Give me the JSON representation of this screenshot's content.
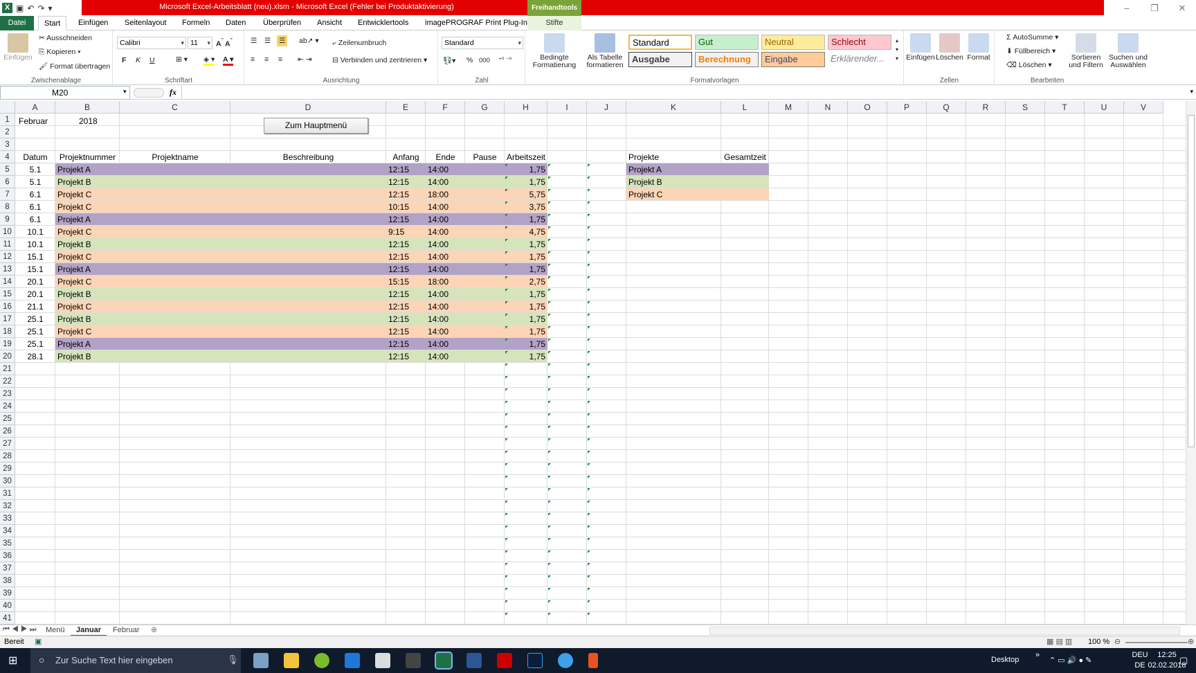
{
  "window": {
    "title": "Microsoft Excel-Arbeitsblatt (neu).xlsm  -  Microsoft Excel (Fehler bei Produktaktivierung)",
    "context_tab": "Freihandtools"
  },
  "tabs": [
    "Datei",
    "Start",
    "Einfügen",
    "Seitenlayout",
    "Formeln",
    "Daten",
    "Überprüfen",
    "Ansicht",
    "Entwicklertools",
    "imagePROGRAF Print Plug-In",
    "Stifte"
  ],
  "ribbon": {
    "clipboard": {
      "label": "Zwischenablage",
      "paste": "Einfügen",
      "cut": "Ausschneiden",
      "copy": "Kopieren",
      "format_painter": "Format übertragen"
    },
    "font": {
      "label": "Schriftart",
      "family": "Calibri",
      "size": "11",
      "bold": "F",
      "italic": "K",
      "underline": "U"
    },
    "alignment": {
      "label": "Ausrichtung",
      "wrap": "Zeilenumbruch",
      "merge": "Verbinden und zentrieren"
    },
    "number": {
      "label": "Zahl",
      "format": "Standard",
      "percent": "%",
      "thousands": "000"
    },
    "styles": {
      "label": "Formatvorlagen",
      "cond_format": "Bedingte Formatierung",
      "as_table": "Als Tabelle formatieren",
      "items": [
        "Standard",
        "Gut",
        "Neutral",
        "Schlecht",
        "Ausgabe",
        "Berechnung",
        "Eingabe",
        "Erklärender..."
      ]
    },
    "cells": {
      "label": "Zellen",
      "insert": "Einfügen",
      "delete": "Löschen",
      "format": "Format"
    },
    "editing": {
      "label": "Bearbeiten",
      "autosum": "AutoSumme",
      "fill": "Füllbereich",
      "clear": "Löschen",
      "sort": "Sortieren und Filtern",
      "find": "Suchen und Auswählen"
    }
  },
  "formula_bar": {
    "name_box": "M20",
    "fx": "fx",
    "value": ""
  },
  "columns": [
    "A",
    "B",
    "C",
    "D",
    "E",
    "F",
    "G",
    "H",
    "I",
    "J",
    "K",
    "L",
    "M",
    "N",
    "O",
    "P",
    "Q",
    "R",
    "S",
    "T",
    "U",
    "V"
  ],
  "rows_count": 41,
  "header_cells": {
    "A1": "Februar",
    "B1": "2018",
    "button": "Zum Hauptmenü"
  },
  "table_headers": [
    "Datum",
    "Projektnummer",
    "Projektname",
    "Beschreibung",
    "Anfang",
    "Ende",
    "Pause",
    "Arbeitszeit"
  ],
  "entries": [
    {
      "datum": "5.1",
      "projekt": "Projekt A",
      "anfang": "12:15",
      "ende": "14:00",
      "zeit": "1,75"
    },
    {
      "datum": "5.1",
      "projekt": "Projekt B",
      "anfang": "12:15",
      "ende": "14:00",
      "zeit": "1,75"
    },
    {
      "datum": "6.1",
      "projekt": "Projekt C",
      "anfang": "12:15",
      "ende": "18:00",
      "zeit": "5,75"
    },
    {
      "datum": "6.1",
      "projekt": "Projekt C",
      "anfang": "10:15",
      "ende": "14:00",
      "zeit": "3,75"
    },
    {
      "datum": "6.1",
      "projekt": "Projekt A",
      "anfang": "12:15",
      "ende": "14:00",
      "zeit": "1,75"
    },
    {
      "datum": "10.1",
      "projekt": "Projekt C",
      "anfang": "9:15",
      "ende": "14:00",
      "zeit": "4,75"
    },
    {
      "datum": "10.1",
      "projekt": "Projekt B",
      "anfang": "12:15",
      "ende": "14:00",
      "zeit": "1,75"
    },
    {
      "datum": "15.1",
      "projekt": "Projekt C",
      "anfang": "12:15",
      "ende": "14:00",
      "zeit": "1,75"
    },
    {
      "datum": "15.1",
      "projekt": "Projekt A",
      "anfang": "12:15",
      "ende": "14:00",
      "zeit": "1,75"
    },
    {
      "datum": "20.1",
      "projekt": "Projekt C",
      "anfang": "15:15",
      "ende": "18:00",
      "zeit": "2,75"
    },
    {
      "datum": "20.1",
      "projekt": "Projekt B",
      "anfang": "12:15",
      "ende": "14:00",
      "zeit": "1,75"
    },
    {
      "datum": "21.1",
      "projekt": "Projekt C",
      "anfang": "12:15",
      "ende": "14:00",
      "zeit": "1,75"
    },
    {
      "datum": "25.1",
      "projekt": "Projekt B",
      "anfang": "12:15",
      "ende": "14:00",
      "zeit": "1,75"
    },
    {
      "datum": "25.1",
      "projekt": "Projekt C",
      "anfang": "12:15",
      "ende": "14:00",
      "zeit": "1,75"
    },
    {
      "datum": "25.1",
      "projekt": "Projekt A",
      "anfang": "12:15",
      "ende": "14:00",
      "zeit": "1,75"
    },
    {
      "datum": "28.1",
      "projekt": "Projekt B",
      "anfang": "12:15",
      "ende": "14:00",
      "zeit": "1,75"
    }
  ],
  "summary": {
    "headers": [
      "Projekte",
      "Gesamtzeit"
    ],
    "projects": [
      "Projekt A",
      "Projekt B",
      "Projekt C"
    ]
  },
  "colors": {
    "Projekt A": "#b3a2c7",
    "Projekt B": "#d6e4bc",
    "Projekt C": "#fbd5b5",
    "excel_green": "#1e7145",
    "title_red": "#e20000"
  },
  "sheet_tabs": [
    "Menü",
    "Januar",
    "Februar"
  ],
  "active_sheet": "Januar",
  "status": {
    "ready": "Bereit",
    "zoom": "100 %"
  },
  "taskbar": {
    "search": "Zur Suche Text hier eingeben",
    "desktop": "Desktop",
    "lang1": "DEU",
    "lang2": "DE",
    "time": "12:25",
    "date": "02.02.2018"
  }
}
